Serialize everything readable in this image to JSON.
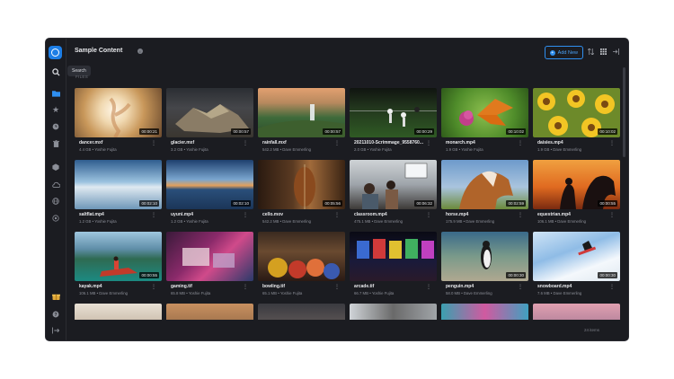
{
  "header": {
    "title": "Sample Content",
    "add_new": "Add New"
  },
  "tooltip": "Search",
  "section_label": "FILES",
  "footer": {
    "count": "24 items"
  },
  "rail_icons": [
    "search-icon",
    "folder-icon",
    "star-icon",
    "clock-icon",
    "trash-icon",
    "box-icon",
    "cloud-icon",
    "globe-icon",
    "target-icon",
    "gift-icon",
    "help-icon",
    "logout-icon"
  ],
  "files": [
    {
      "name": "dancer.mxf",
      "meta": "4.4 GB • Yoshie Fujita",
      "duration": "00:00:21"
    },
    {
      "name": "glacier.mxf",
      "meta": "3.2 GB • Yoshie Fujita",
      "duration": "00:00:57"
    },
    {
      "name": "rainfall.mxf",
      "meta": "542.2 MB • Dave Emmerling",
      "duration": "00:00:57"
    },
    {
      "name": "20211010-Scrimmage_9558760...",
      "meta": "2.0 GB • Yoshie Fujita",
      "duration": "00:00:29"
    },
    {
      "name": "monarch.mp4",
      "meta": "1.9 GB • Yoshie Fujita",
      "duration": "00:10:02"
    },
    {
      "name": "daisies.mp4",
      "meta": "1.9 GB • Dave Emmerling",
      "duration": "00:10:02"
    },
    {
      "name": "saltflat.mp4",
      "meta": "1.2 GB • Yoshie Fujita",
      "duration": "00:02:10"
    },
    {
      "name": "uyuni.mp4",
      "meta": "1.2 GB • Yoshie Fujita",
      "duration": "00:02:10"
    },
    {
      "name": "cello.mov",
      "meta": "542.2 MB • Dave Emmerling",
      "duration": "00:05:56"
    },
    {
      "name": "classroom.mp4",
      "meta": "475.1 MB • Dave Emmerling",
      "duration": "00:06:32"
    },
    {
      "name": "horse.mp4",
      "meta": "175.9 MB • Dave Emmerling",
      "duration": "00:02:59"
    },
    {
      "name": "equestrian.mp4",
      "meta": "106.1 MB • Dave Emmerling",
      "duration": "00:00:55"
    },
    {
      "name": "kayak.mp4",
      "meta": "106.1 MB • Dave Emmerling",
      "duration": "00:00:55"
    },
    {
      "name": "gaming.tif",
      "meta": "65.8 MB • Yoshie Fujita",
      "duration": ""
    },
    {
      "name": "bowling.tif",
      "meta": "65.1 MB • Yoshie Fujita",
      "duration": ""
    },
    {
      "name": "arcade.tif",
      "meta": "66.7 MB • Yoshie Fujita",
      "duration": ""
    },
    {
      "name": "penguin.mp4",
      "meta": "58.0 MB • Dave Emmerling",
      "duration": "00:00:30"
    },
    {
      "name": "snowboard.mp4",
      "meta": "7.6 MB • Dave Emmerling",
      "duration": "00:00:30"
    },
    {
      "name": "",
      "meta": "",
      "duration": ""
    },
    {
      "name": "",
      "meta": "",
      "duration": ""
    },
    {
      "name": "",
      "meta": "",
      "duration": ""
    },
    {
      "name": "",
      "meta": "",
      "duration": ""
    },
    {
      "name": "",
      "meta": "",
      "duration": ""
    },
    {
      "name": "",
      "meta": "",
      "duration": ""
    }
  ]
}
